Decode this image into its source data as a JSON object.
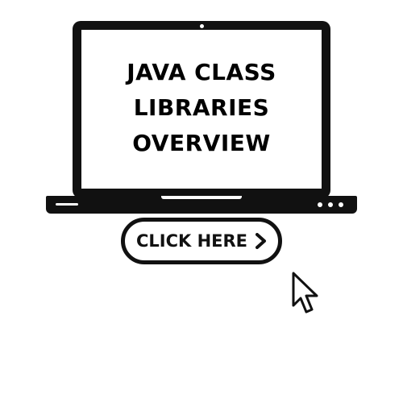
{
  "screen": {
    "title_lines": [
      "JAVA CLASS",
      "LIBRARIES",
      "OVERVIEW"
    ]
  },
  "cta": {
    "label": "CLICK HERE",
    "icon": "chevron-right-icon"
  },
  "cursor": {
    "icon": "mouse-pointer-icon"
  },
  "colors": {
    "background": "#ffffff",
    "laptop": "#111111",
    "text": "#000000"
  }
}
